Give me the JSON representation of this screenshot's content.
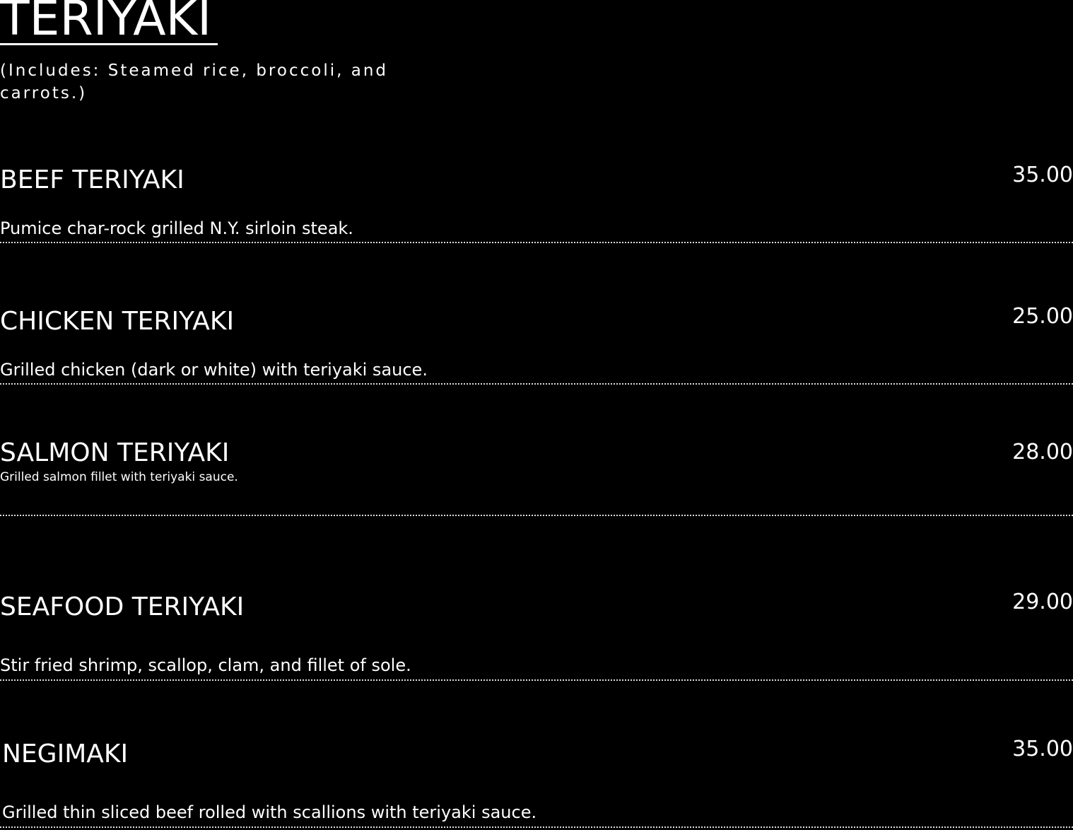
{
  "section": {
    "title": "TERIYAKI",
    "note": "(Includes: Steamed rice, broccoli, and carrots.)"
  },
  "items": [
    {
      "name": "BEEF TERIYAKI",
      "price": "35.00",
      "description": "Pumice char-rock grilled N.Y. sirloin steak."
    },
    {
      "name": "CHICKEN TERIYAKI",
      "price": "25.00",
      "description": "Grilled chicken (dark or white) with teriyaki sauce."
    },
    {
      "name": "SALMON TERIYAKI",
      "price": "28.00",
      "description": "Grilled salmon fillet with teriyaki sauce."
    },
    {
      "name": "SEAFOOD TERIYAKI",
      "price": "29.00",
      "description": "Stir fried shrimp, scallop, clam, and fillet of sole."
    },
    {
      "name": "NEGIMAKI",
      "price": "35.00",
      "description": "Grilled thin sliced beef rolled with scallions with teriyaki sauce."
    }
  ],
  "colors": {
    "background": "#000000",
    "text": "#ffffff",
    "divider": "#dcdcdc"
  }
}
